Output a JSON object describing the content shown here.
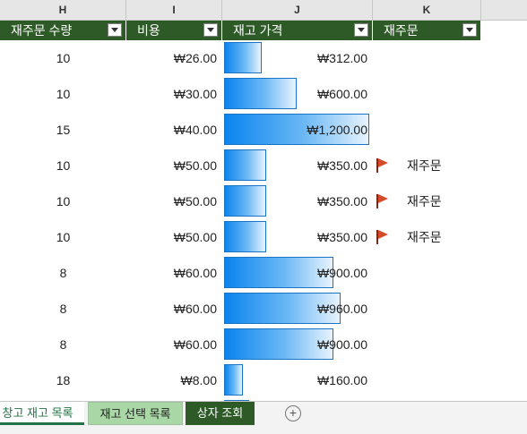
{
  "column_headers": [
    "H",
    "I",
    "J",
    "K"
  ],
  "table_headers": {
    "h": "재주문 수량",
    "i": "비용",
    "j": "재고 가격",
    "k": "재주문"
  },
  "rows": [
    {
      "qty": "10",
      "cost": "₩26.00",
      "value": "₩312.00",
      "reorder": "",
      "flag": false,
      "bar_fraction": 0.26
    },
    {
      "qty": "10",
      "cost": "₩30.00",
      "value": "₩600.00",
      "reorder": "",
      "flag": false,
      "bar_fraction": 0.5
    },
    {
      "qty": "15",
      "cost": "₩40.00",
      "value": "₩1,200.00",
      "reorder": "",
      "flag": false,
      "bar_fraction": 1.0
    },
    {
      "qty": "10",
      "cost": "₩50.00",
      "value": "₩350.00",
      "reorder": "재주문",
      "flag": true,
      "bar_fraction": 0.29
    },
    {
      "qty": "10",
      "cost": "₩50.00",
      "value": "₩350.00",
      "reorder": "재주문",
      "flag": true,
      "bar_fraction": 0.29
    },
    {
      "qty": "10",
      "cost": "₩50.00",
      "value": "₩350.00",
      "reorder": "재주문",
      "flag": true,
      "bar_fraction": 0.29
    },
    {
      "qty": "8",
      "cost": "₩60.00",
      "value": "₩900.00",
      "reorder": "",
      "flag": false,
      "bar_fraction": 0.75
    },
    {
      "qty": "8",
      "cost": "₩60.00",
      "value": "₩960.00",
      "reorder": "",
      "flag": false,
      "bar_fraction": 0.8
    },
    {
      "qty": "8",
      "cost": "₩60.00",
      "value": "₩900.00",
      "reorder": "",
      "flag": false,
      "bar_fraction": 0.75
    },
    {
      "qty": "18",
      "cost": "₩8.00",
      "value": "₩160.00",
      "reorder": "",
      "flag": false,
      "bar_fraction": 0.13
    },
    {
      "qty": "",
      "cost": "",
      "value": "",
      "reorder": "",
      "flag": false,
      "bar_fraction": 0.17
    }
  ],
  "sheet_tabs": [
    {
      "label": "창고 재고 목록",
      "active": true
    },
    {
      "label": "재고 선택 목록",
      "active": false
    },
    {
      "label": "상자 조회",
      "active": false
    }
  ],
  "add_sheet_icon": "plus-circle-icon",
  "colors": {
    "header_green": "#2d5a27",
    "bar_blue": "#0a84ee",
    "flag_red": "#d44a2a",
    "tab_light_green": "#a9d8a6"
  }
}
